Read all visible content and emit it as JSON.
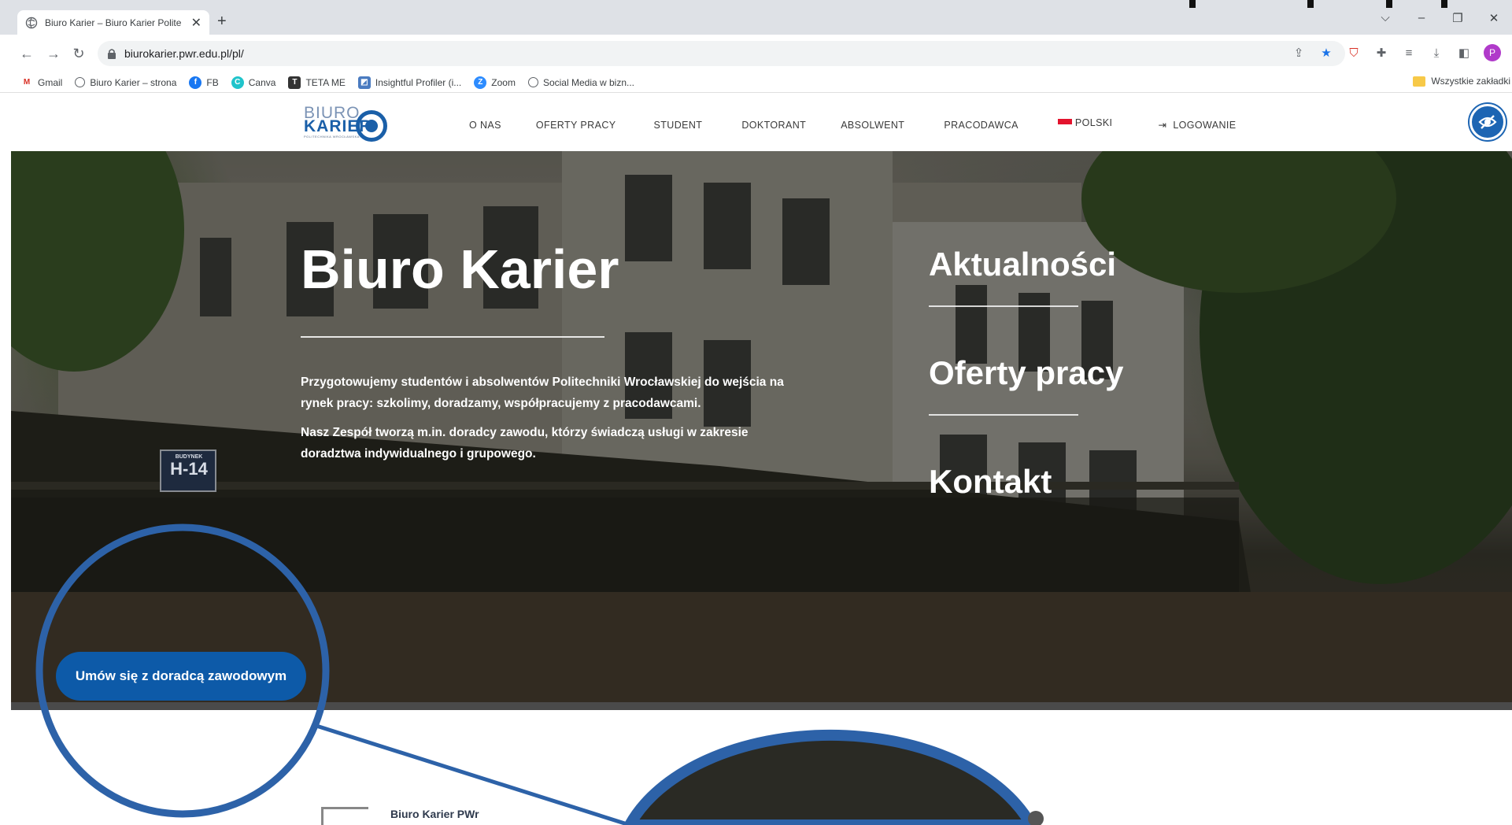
{
  "browser": {
    "tab_title": "Biuro Karier – Biuro Karier Polite",
    "url": "biurokarier.pwr.edu.pl/pl/",
    "profile_initial": "P",
    "bookmarks": [
      "Gmail",
      "Biuro Karier – strona",
      "FB",
      "Canva",
      "TETA ME",
      "Insightful Profiler (i...",
      "Zoom",
      "Social Media w bizn..."
    ],
    "bookmarks_right": "Wszystkie zakładki"
  },
  "site": {
    "logo": {
      "line1": "BIURO",
      "line2": "KARIER",
      "line3": "POLITECHNIKA WROCŁAWSKA"
    },
    "menu": [
      "O NAS",
      "OFERTY PRACY",
      "STUDENT",
      "DOKTORANT",
      "ABSOLWENT",
      "PRACODAWCA"
    ],
    "language": "POLSKI",
    "login": "LOGOWANIE",
    "brand_color": "#0d5aa8"
  },
  "hero": {
    "title": "Biuro Karier",
    "paragraphs": [
      "Przygotowujemy studentów i absolwentów Politechniki Wrocławskiej do wejścia na rynek pracy: szkolimy, doradzamy, współpracujemy z pracodawcami.",
      "Nasz Zespół tworzą m.in. doradcy zawodu, którzy świadczą usługi w zakresie doradztwa indywidualnego i grupowego."
    ],
    "links": [
      "Aktualności",
      "Oferty pracy",
      "Kontakt"
    ],
    "cta": "Umów się z doradcą zawodowym",
    "building_sign": {
      "line1": "BUDYNEK",
      "line2": "H-14"
    }
  },
  "footer_preview": {
    "label": "Biuro Karier PWr"
  },
  "annotation_color": "#2d62a8"
}
